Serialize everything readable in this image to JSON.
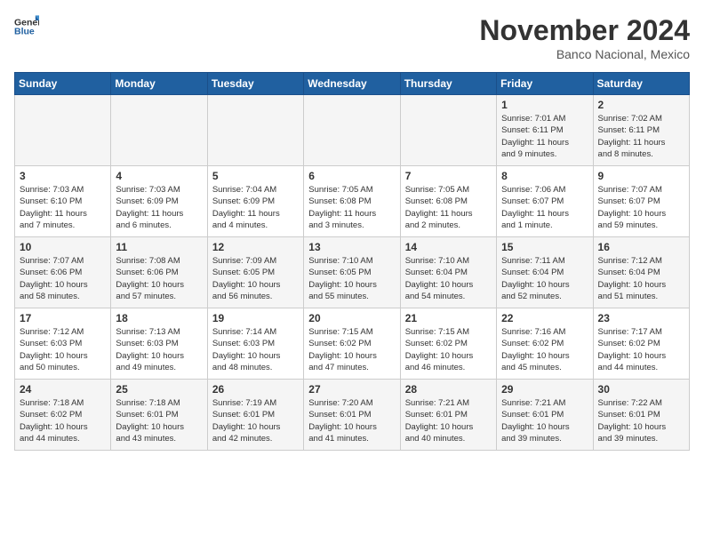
{
  "logo": {
    "text_general": "General",
    "text_blue": "Blue"
  },
  "title": "November 2024",
  "location": "Banco Nacional, Mexico",
  "days_of_week": [
    "Sunday",
    "Monday",
    "Tuesday",
    "Wednesday",
    "Thursday",
    "Friday",
    "Saturday"
  ],
  "weeks": [
    [
      {
        "day": "",
        "info": ""
      },
      {
        "day": "",
        "info": ""
      },
      {
        "day": "",
        "info": ""
      },
      {
        "day": "",
        "info": ""
      },
      {
        "day": "",
        "info": ""
      },
      {
        "day": "1",
        "info": "Sunrise: 7:01 AM\nSunset: 6:11 PM\nDaylight: 11 hours\nand 9 minutes."
      },
      {
        "day": "2",
        "info": "Sunrise: 7:02 AM\nSunset: 6:11 PM\nDaylight: 11 hours\nand 8 minutes."
      }
    ],
    [
      {
        "day": "3",
        "info": "Sunrise: 7:03 AM\nSunset: 6:10 PM\nDaylight: 11 hours\nand 7 minutes."
      },
      {
        "day": "4",
        "info": "Sunrise: 7:03 AM\nSunset: 6:09 PM\nDaylight: 11 hours\nand 6 minutes."
      },
      {
        "day": "5",
        "info": "Sunrise: 7:04 AM\nSunset: 6:09 PM\nDaylight: 11 hours\nand 4 minutes."
      },
      {
        "day": "6",
        "info": "Sunrise: 7:05 AM\nSunset: 6:08 PM\nDaylight: 11 hours\nand 3 minutes."
      },
      {
        "day": "7",
        "info": "Sunrise: 7:05 AM\nSunset: 6:08 PM\nDaylight: 11 hours\nand 2 minutes."
      },
      {
        "day": "8",
        "info": "Sunrise: 7:06 AM\nSunset: 6:07 PM\nDaylight: 11 hours\nand 1 minute."
      },
      {
        "day": "9",
        "info": "Sunrise: 7:07 AM\nSunset: 6:07 PM\nDaylight: 10 hours\nand 59 minutes."
      }
    ],
    [
      {
        "day": "10",
        "info": "Sunrise: 7:07 AM\nSunset: 6:06 PM\nDaylight: 10 hours\nand 58 minutes."
      },
      {
        "day": "11",
        "info": "Sunrise: 7:08 AM\nSunset: 6:06 PM\nDaylight: 10 hours\nand 57 minutes."
      },
      {
        "day": "12",
        "info": "Sunrise: 7:09 AM\nSunset: 6:05 PM\nDaylight: 10 hours\nand 56 minutes."
      },
      {
        "day": "13",
        "info": "Sunrise: 7:10 AM\nSunset: 6:05 PM\nDaylight: 10 hours\nand 55 minutes."
      },
      {
        "day": "14",
        "info": "Sunrise: 7:10 AM\nSunset: 6:04 PM\nDaylight: 10 hours\nand 54 minutes."
      },
      {
        "day": "15",
        "info": "Sunrise: 7:11 AM\nSunset: 6:04 PM\nDaylight: 10 hours\nand 52 minutes."
      },
      {
        "day": "16",
        "info": "Sunrise: 7:12 AM\nSunset: 6:04 PM\nDaylight: 10 hours\nand 51 minutes."
      }
    ],
    [
      {
        "day": "17",
        "info": "Sunrise: 7:12 AM\nSunset: 6:03 PM\nDaylight: 10 hours\nand 50 minutes."
      },
      {
        "day": "18",
        "info": "Sunrise: 7:13 AM\nSunset: 6:03 PM\nDaylight: 10 hours\nand 49 minutes."
      },
      {
        "day": "19",
        "info": "Sunrise: 7:14 AM\nSunset: 6:03 PM\nDaylight: 10 hours\nand 48 minutes."
      },
      {
        "day": "20",
        "info": "Sunrise: 7:15 AM\nSunset: 6:02 PM\nDaylight: 10 hours\nand 47 minutes."
      },
      {
        "day": "21",
        "info": "Sunrise: 7:15 AM\nSunset: 6:02 PM\nDaylight: 10 hours\nand 46 minutes."
      },
      {
        "day": "22",
        "info": "Sunrise: 7:16 AM\nSunset: 6:02 PM\nDaylight: 10 hours\nand 45 minutes."
      },
      {
        "day": "23",
        "info": "Sunrise: 7:17 AM\nSunset: 6:02 PM\nDaylight: 10 hours\nand 44 minutes."
      }
    ],
    [
      {
        "day": "24",
        "info": "Sunrise: 7:18 AM\nSunset: 6:02 PM\nDaylight: 10 hours\nand 44 minutes."
      },
      {
        "day": "25",
        "info": "Sunrise: 7:18 AM\nSunset: 6:01 PM\nDaylight: 10 hours\nand 43 minutes."
      },
      {
        "day": "26",
        "info": "Sunrise: 7:19 AM\nSunset: 6:01 PM\nDaylight: 10 hours\nand 42 minutes."
      },
      {
        "day": "27",
        "info": "Sunrise: 7:20 AM\nSunset: 6:01 PM\nDaylight: 10 hours\nand 41 minutes."
      },
      {
        "day": "28",
        "info": "Sunrise: 7:21 AM\nSunset: 6:01 PM\nDaylight: 10 hours\nand 40 minutes."
      },
      {
        "day": "29",
        "info": "Sunrise: 7:21 AM\nSunset: 6:01 PM\nDaylight: 10 hours\nand 39 minutes."
      },
      {
        "day": "30",
        "info": "Sunrise: 7:22 AM\nSunset: 6:01 PM\nDaylight: 10 hours\nand 39 minutes."
      }
    ]
  ]
}
